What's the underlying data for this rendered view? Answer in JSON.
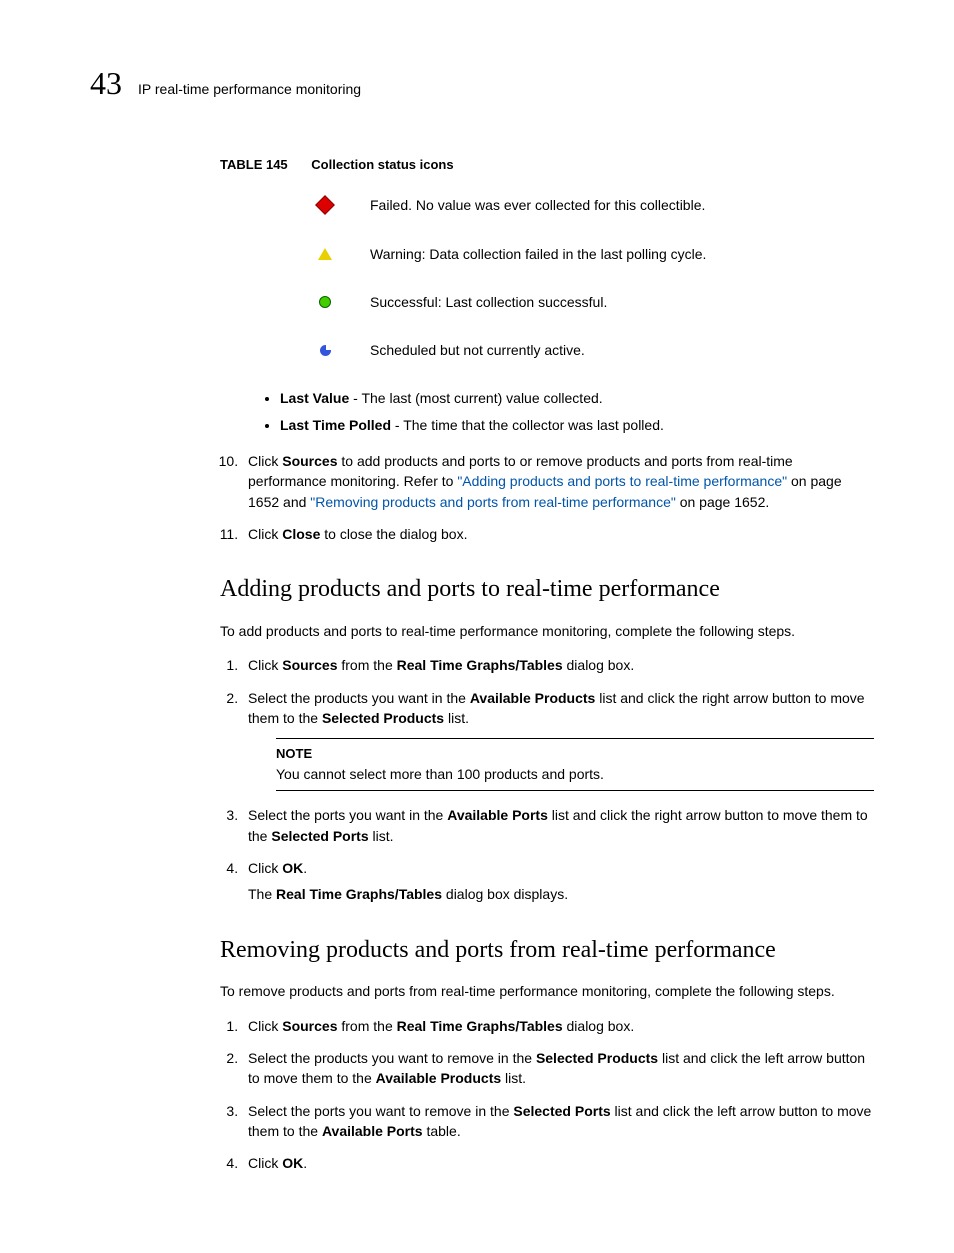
{
  "header": {
    "chapter_number": "43",
    "chapter_title": "IP real-time performance monitoring"
  },
  "table": {
    "label": "TABLE 145",
    "title": "Collection status icons",
    "rows": {
      "failed": "Failed. No value was ever collected for this collectible.",
      "warning": "Warning: Data collection failed in the last polling cycle.",
      "success": "Successful: Last collection successful.",
      "scheduled": "Scheduled but not currently active."
    }
  },
  "bullets": {
    "last_value_label": "Last Value",
    "last_value_text": " - The last (most current) value collected.",
    "last_time_label": "Last Time Polled",
    "last_time_text": " - The time that the collector was last polled."
  },
  "steps_top": {
    "s10_a": "Click ",
    "s10_sources": "Sources",
    "s10_b": " to add products and ports to or remove products and ports from real-time performance monitoring. Refer to ",
    "s10_link1": "\"Adding products and ports to real-time performance\"",
    "s10_c": " on page 1652 and ",
    "s10_link2": "\"Removing products and ports from real-time performance\"",
    "s10_d": " on page 1652.",
    "s11_a": "Click ",
    "s11_close": "Close",
    "s11_b": " to close the dialog box."
  },
  "section_add": {
    "heading": "Adding products and ports to real-time performance",
    "intro": "To add products and ports to real-time performance monitoring, complete the following steps.",
    "s1_a": "Click ",
    "s1_b": "Sources",
    "s1_c": " from the ",
    "s1_d": "Real Time Graphs/Tables",
    "s1_e": " dialog box.",
    "s2_a": "Select the products you want in the ",
    "s2_b": "Available Products",
    "s2_c": " list and click the right arrow button to move them to the ",
    "s2_d": "Selected Products",
    "s2_e": " list.",
    "note_label": "NOTE",
    "note_text": "You cannot select more than 100 products and ports.",
    "s3_a": "Select the ports you want in the ",
    "s3_b": "Available Ports",
    "s3_c": " list and click the right arrow button to move them to the ",
    "s3_d": "Selected Ports",
    "s3_e": " list.",
    "s4_a": "Click ",
    "s4_b": "OK",
    "s4_c": ".",
    "s4_sub_a": "The ",
    "s4_sub_b": "Real Time Graphs/Tables",
    "s4_sub_c": " dialog box displays."
  },
  "section_remove": {
    "heading": "Removing products and ports from real-time performance",
    "intro": "To remove products and ports from real-time performance monitoring, complete the following steps.",
    "s1_a": "Click ",
    "s1_b": "Sources",
    "s1_c": " from the ",
    "s1_d": "Real Time Graphs/Tables",
    "s1_e": " dialog box.",
    "s2_a": "Select the products you want to remove in the ",
    "s2_b": "Selected Products",
    "s2_c": " list and click the left arrow button to move them to the ",
    "s2_d": "Available Products",
    "s2_e": " list.",
    "s3_a": "Select the ports you want to remove in the ",
    "s3_b": "Selected Ports",
    "s3_c": " list and click the left arrow button to move them to the ",
    "s3_d": "Available Ports",
    "s3_e": " table.",
    "s4_a": "Click ",
    "s4_b": "OK",
    "s4_c": "."
  }
}
